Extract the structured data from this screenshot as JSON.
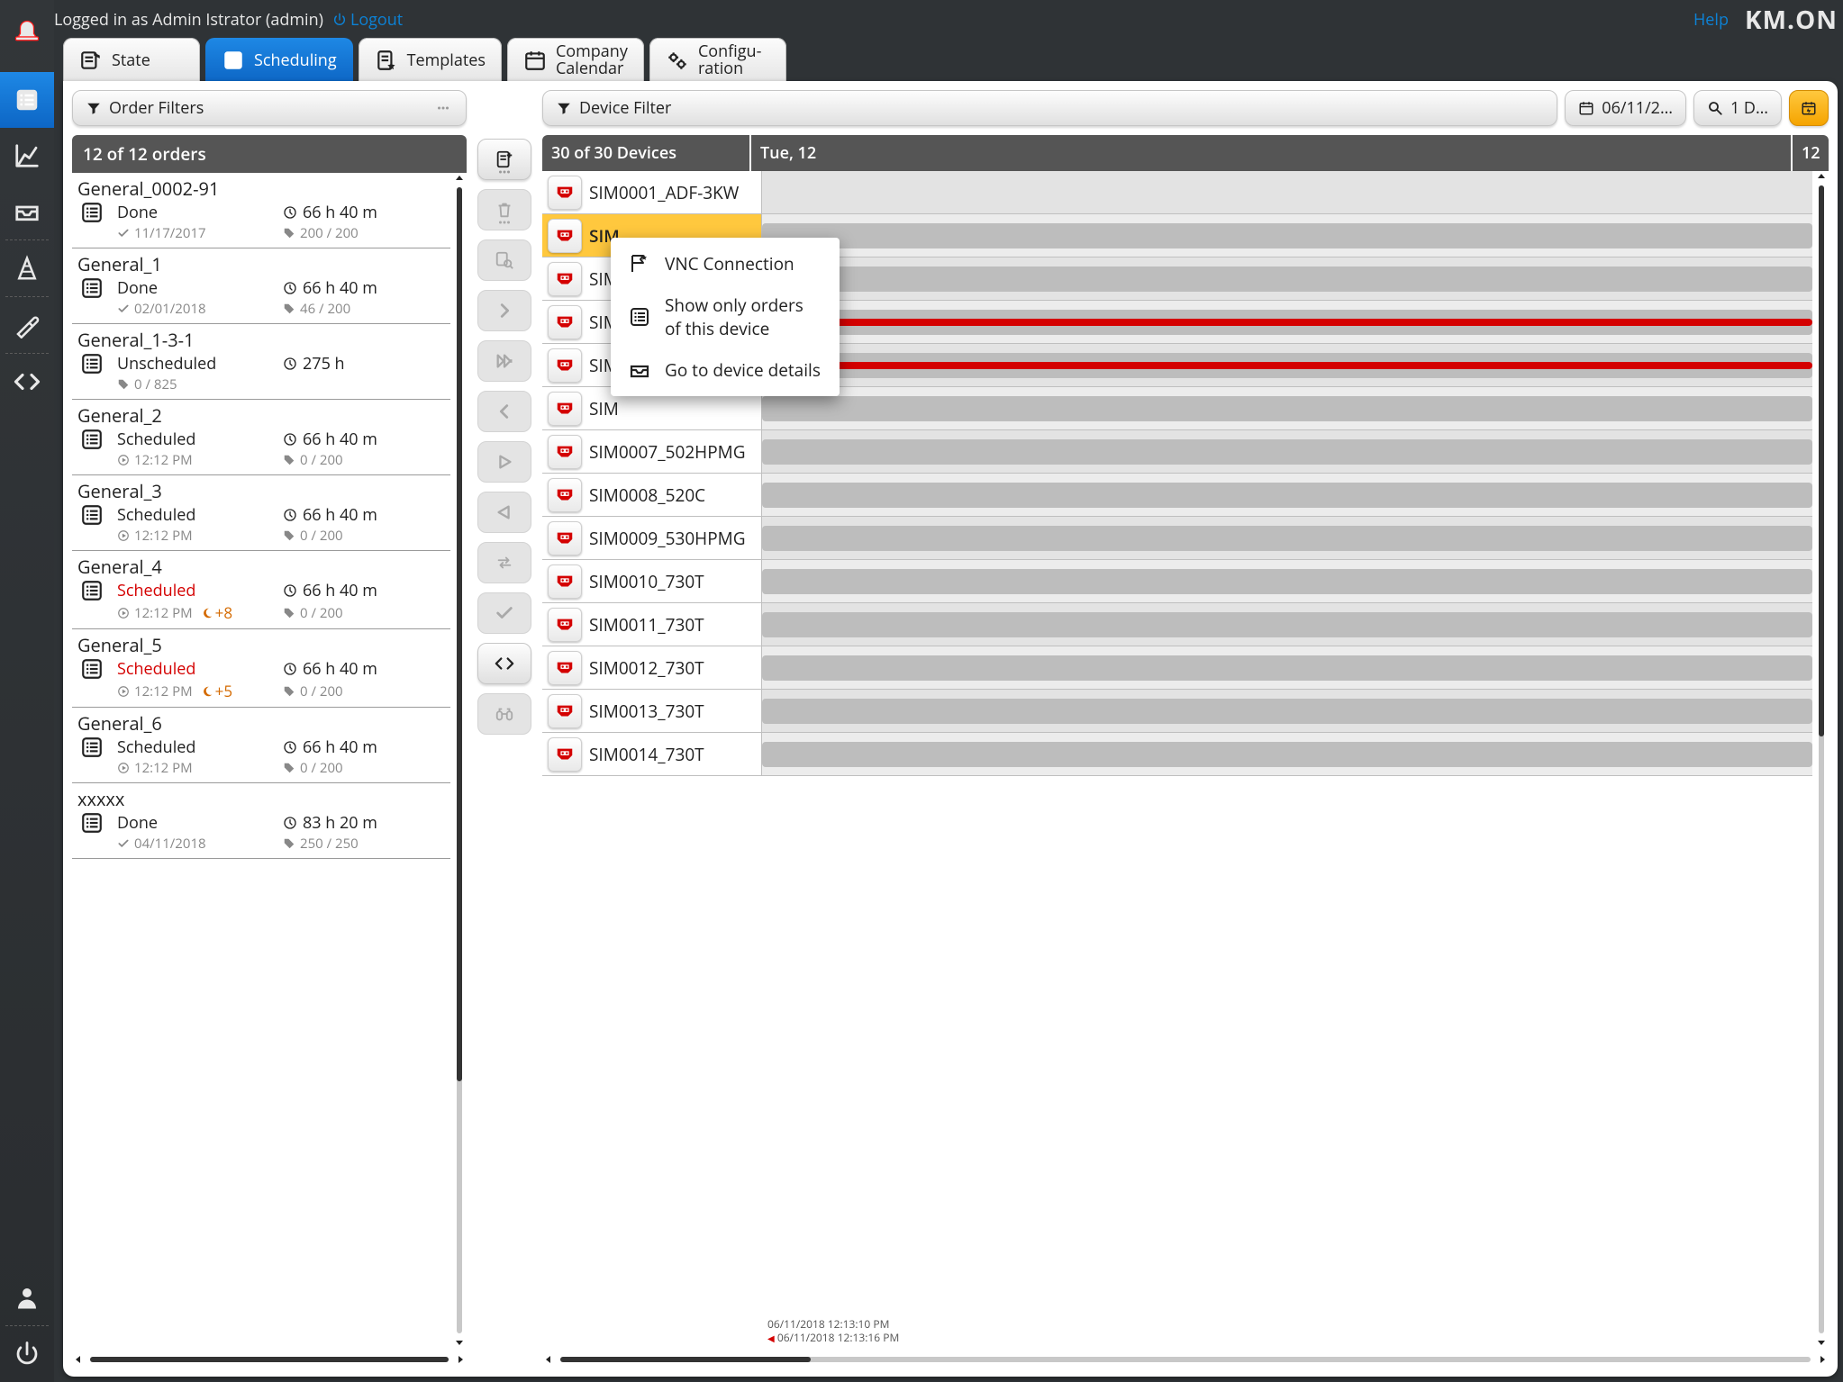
{
  "header": {
    "logged_in": "Logged in as Admin Istrator (admin)",
    "logout": "Logout",
    "help": "Help",
    "brand": "KM.ON"
  },
  "sidebar": {
    "items": [
      {
        "name": "alarm-icon"
      },
      {
        "name": "list-icon",
        "active": true
      },
      {
        "name": "chart-icon"
      },
      {
        "name": "tray-icon"
      },
      {
        "name": "cone-icon"
      },
      {
        "name": "screwdriver-icon"
      },
      {
        "name": "code-icon"
      },
      {
        "name": "user-icon"
      },
      {
        "name": "power-icon"
      }
    ]
  },
  "tabs": [
    {
      "label": "State"
    },
    {
      "label": "Scheduling",
      "active": true
    },
    {
      "label": "Templates"
    },
    {
      "label": "Company\nCalendar"
    },
    {
      "label": "Configu-\nration"
    }
  ],
  "orders": {
    "filter_button": "Order Filters",
    "title": "12 of 12 orders",
    "items": [
      {
        "name": "General_0002-91",
        "status": "Done",
        "date": "11/17/2017",
        "check": true,
        "dur": "66 h 40 m",
        "qty": "200 / 200"
      },
      {
        "name": "General_1",
        "status": "Done",
        "date": "02/01/2018",
        "check": true,
        "dur": "66 h 40 m",
        "qty": "46 / 200"
      },
      {
        "name": "General_1-3-1",
        "status": "Unscheduled",
        "date": "",
        "qsub": "0 / 825",
        "dur": "275 h"
      },
      {
        "name": "General_2",
        "status": "Scheduled",
        "time": "12:12 PM",
        "dur": "66 h 40 m",
        "qty": "0 / 200"
      },
      {
        "name": "General_3",
        "status": "Scheduled",
        "time": "12:12 PM",
        "dur": "66 h 40 m",
        "qty": "0 / 200"
      },
      {
        "name": "General_4",
        "status": "Scheduled",
        "time": "12:12 PM",
        "shift": "+8",
        "dur": "66 h 40 m",
        "qty": "0 / 200",
        "warn": true
      },
      {
        "name": "General_5",
        "status": "Scheduled",
        "time": "12:12 PM",
        "shift": "+5",
        "dur": "66 h 40 m",
        "qty": "0 / 200",
        "warn": true
      },
      {
        "name": "General_6",
        "status": "Scheduled",
        "time": "12:12 PM",
        "dur": "66 h 40 m",
        "qty": "0 / 200"
      },
      {
        "name": "xxxxx",
        "status": "Done",
        "date": "04/11/2018",
        "check": true,
        "dur": "83 h 20 m",
        "qty": "250 / 250"
      }
    ]
  },
  "actions": [
    {
      "name": "add-icon",
      "enabled": true
    },
    {
      "name": "trash-icon",
      "enabled": false
    },
    {
      "name": "inspect-icon",
      "enabled": false
    },
    {
      "name": "chevron-right-icon",
      "enabled": false
    },
    {
      "name": "fastfwd-icon",
      "enabled": false
    },
    {
      "name": "chevron-left-icon",
      "enabled": false
    },
    {
      "name": "play-icon",
      "enabled": false
    },
    {
      "name": "triangle-left-icon",
      "enabled": false
    },
    {
      "name": "swap-icon",
      "enabled": false
    },
    {
      "name": "check-icon",
      "enabled": false
    },
    {
      "name": "code-icon",
      "enabled": true
    },
    {
      "name": "binoculars-icon",
      "enabled": false
    }
  ],
  "devices": {
    "filter_button": "Device Filter",
    "date_button": "06/11/2…",
    "zoom_button": "1 D…",
    "title": "30 of 30 Devices",
    "day_label": "Tue, 12",
    "day_num": "12",
    "timestamps": [
      "06/11/2018 12:13:10 PM",
      "06/11/2018 12:13:16 PM"
    ],
    "rows": [
      {
        "name": "SIM0001_ADF-3KW"
      },
      {
        "name": "SIM",
        "partial": true,
        "selected": true,
        "tl": [
          [
            0,
            1,
            "gray"
          ]
        ]
      },
      {
        "name": "SIM",
        "partial": true,
        "tl": [
          [
            0,
            1,
            "gray"
          ]
        ]
      },
      {
        "name": "SIM",
        "partial": true,
        "tl": [
          [
            0,
            1,
            "gray"
          ],
          [
            0,
            1,
            "red"
          ]
        ]
      },
      {
        "name": "SIM",
        "partial": true,
        "tl": [
          [
            0,
            1,
            "gray"
          ],
          [
            0,
            1,
            "red"
          ]
        ]
      },
      {
        "name": "SIM",
        "partial": true,
        "tl": [
          [
            0,
            1,
            "gray"
          ]
        ]
      },
      {
        "name": "SIM0007_502HPMG",
        "tl": [
          [
            0,
            1,
            "gray"
          ]
        ]
      },
      {
        "name": "SIM0008_520C",
        "tl": [
          [
            0,
            1,
            "gray"
          ]
        ]
      },
      {
        "name": "SIM0009_530HPMG",
        "tl": [
          [
            0,
            1,
            "gray"
          ]
        ]
      },
      {
        "name": "SIM0010_730T",
        "tl": [
          [
            0,
            1,
            "gray"
          ]
        ]
      },
      {
        "name": "SIM0011_730T",
        "tl": [
          [
            0,
            1,
            "gray"
          ]
        ]
      },
      {
        "name": "SIM0012_730T",
        "tl": [
          [
            0,
            1,
            "gray"
          ]
        ]
      },
      {
        "name": "SIM0013_730T",
        "tl": [
          [
            0,
            1,
            "gray"
          ]
        ]
      },
      {
        "name": "SIM0014_730T",
        "tl": [
          [
            0,
            1,
            "gray"
          ]
        ]
      }
    ]
  },
  "context_menu": {
    "items": [
      {
        "label": "VNC Connection",
        "icon": "flag-star-icon"
      },
      {
        "label": "Show only orders\nof this device",
        "icon": "list-icon"
      },
      {
        "label": "Go to device details",
        "icon": "tray-icon"
      }
    ]
  }
}
